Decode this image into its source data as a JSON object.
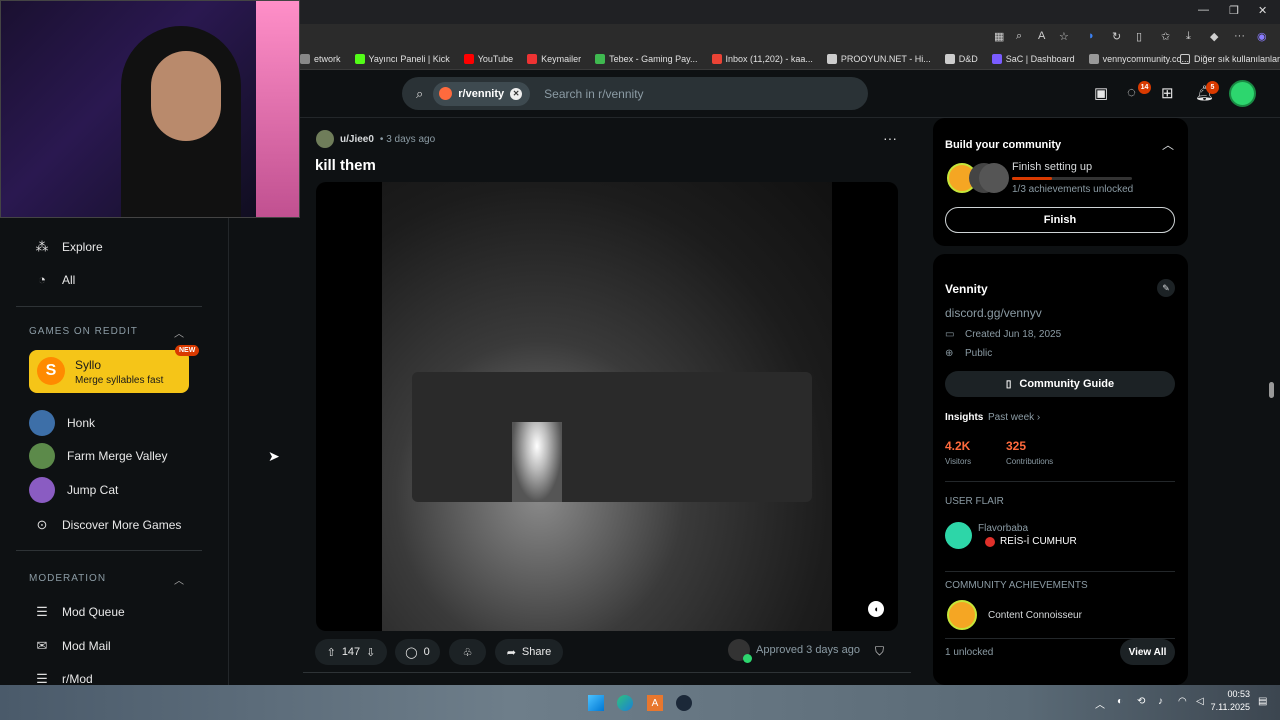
{
  "browser": {
    "bookmarks": [
      {
        "label": "etwork",
        "color": "#888888"
      },
      {
        "label": "Yayıncı Paneli | Kick",
        "color": "#53fc18"
      },
      {
        "label": "YouTube",
        "color": "#ff0000"
      },
      {
        "label": "Keymailer",
        "color": "#e33"
      },
      {
        "label": "Tebex - Gaming Pay...",
        "color": "#3fb950"
      },
      {
        "label": "Inbox (11,202) - kaa...",
        "color": "#ea4335"
      },
      {
        "label": "PROOYUN.NET - Hi...",
        "color": "#cccccc"
      },
      {
        "label": "D&D",
        "color": "#cccccc"
      },
      {
        "label": "SaC | Dashboard",
        "color": "#7a5cff"
      },
      {
        "label": "vennycommunity.co...",
        "color": "#999999"
      }
    ],
    "other_bookmarks": "Diğer sık kullanılanlar"
  },
  "header": {
    "search_chip": "r/vennity",
    "search_placeholder": "Search in r/vennity",
    "chat_badge": "14",
    "notif_badge": "5"
  },
  "sidebar": {
    "top_items": [
      {
        "label": "Explore",
        "icon": "explore-icon"
      },
      {
        "label": "All",
        "icon": "all-icon"
      }
    ],
    "games_title": "GAMES ON REDDIT",
    "featured_game": {
      "title": "Syllo",
      "subtitle": "Merge syllables fast",
      "badge": "NEW"
    },
    "games": [
      {
        "label": "Honk",
        "color": "#3d6fa8"
      },
      {
        "label": "Farm Merge Valley",
        "color": "#5c8a4a"
      },
      {
        "label": "Jump Cat",
        "color": "#8a5cc2"
      }
    ],
    "discover": "Discover More Games",
    "moderation_title": "MODERATION",
    "mod_items": [
      {
        "label": "Mod Queue",
        "icon": "queue-icon"
      },
      {
        "label": "Mod Mail",
        "icon": "mail-icon"
      },
      {
        "label": "r/Mod",
        "icon": "mod-icon"
      }
    ]
  },
  "post": {
    "author": "u/Jiee0",
    "time": "• 3 days ago",
    "title": "kill them",
    "votes": "147",
    "comments": "0",
    "share": "Share",
    "approved": "Approved 3 days ago"
  },
  "right": {
    "build_title": "Build your community",
    "setup": "Finish setting up",
    "achievements": "1/3 achievements unlocked",
    "setup_progress": 0.33,
    "finish": "Finish",
    "community_name": "Vennity",
    "community_desc": "discord.gg/vennyv",
    "created": "Created Jun 18, 2025",
    "visibility": "Public",
    "guide": "Community Guide",
    "insights": "Insights",
    "insights_range": "Past week",
    "visitors_value": "4.2K",
    "visitors_label": "Visitors",
    "contrib_value": "325",
    "contrib_label": "Contributions",
    "user_flair_title": "USER FLAIR",
    "flair_user": "Flavorbaba",
    "flair_text": "REİS-İ CUMHUR",
    "achievements_title": "COMMUNITY ACHIEVEMENTS",
    "achievement_name": "Content Connoisseur",
    "unlocked": "1 unlocked",
    "view_all": "View All"
  },
  "taskbar": {
    "time": "00:53",
    "date": "7.11.2025"
  },
  "colors": {
    "accent_orange": "#d93a00",
    "syllo_yellow": "#f5c518",
    "green": "#2dd66e"
  }
}
